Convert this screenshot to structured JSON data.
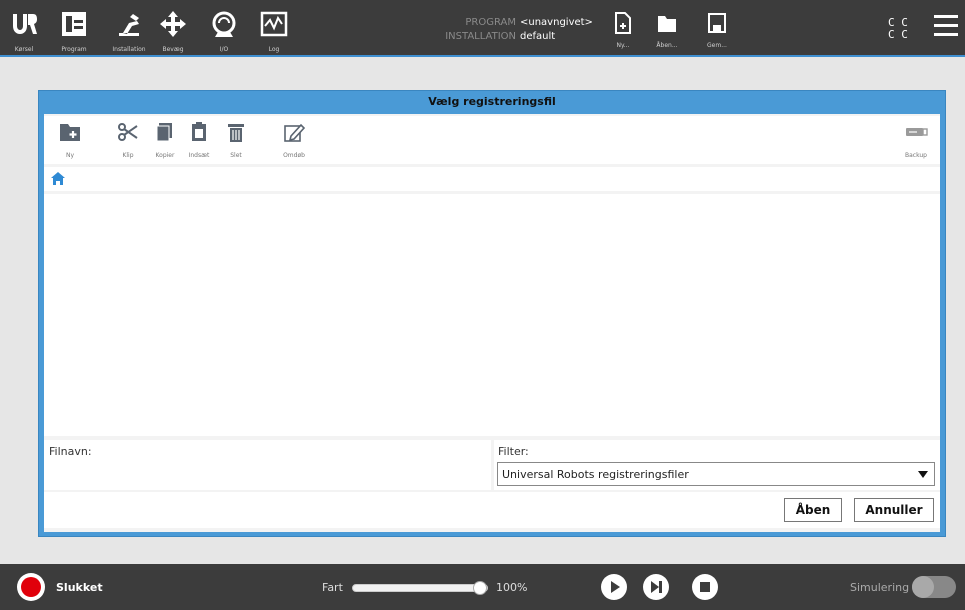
{
  "nav": {
    "items": [
      {
        "label": "Kørsel"
      },
      {
        "label": "Program"
      },
      {
        "label": "Installation"
      },
      {
        "label": "Bevæg"
      },
      {
        "label": "I/O"
      },
      {
        "label": "Log"
      }
    ]
  },
  "program_info": {
    "program_key": "PROGRAM",
    "program_value": "<unavngivet>",
    "installation_key": "INSTALLATION",
    "installation_value": "default"
  },
  "file_actions": {
    "new_label": "Ny...",
    "open_label": "Åben...",
    "save_label": "Gem..."
  },
  "cc": {
    "row1": "C  C",
    "row2": "C  C"
  },
  "dialog": {
    "title": "Vælg registreringsfil",
    "toolbar": {
      "new_label": "Ny",
      "cut_label": "Klip",
      "copy_label": "Kopier",
      "paste_label": "Indsæt",
      "delete_label": "Slet",
      "rename_label": "Omdøb",
      "backup_label": "Backup"
    },
    "filename_label": "Filnavn:",
    "filter_label": "Filter:",
    "filter_value": "Universal Robots registreringsfiler",
    "open_button": "Åben",
    "cancel_button": "Annuller"
  },
  "bottom": {
    "status": "Slukket",
    "speed_label": "Fart",
    "speed_value": "100%",
    "speed_fraction": 1.0,
    "sim_label": "Simulering"
  },
  "colors": {
    "topbar": "#3c3c3c",
    "accent": "#4a9ad6",
    "power": "#e0000b"
  }
}
